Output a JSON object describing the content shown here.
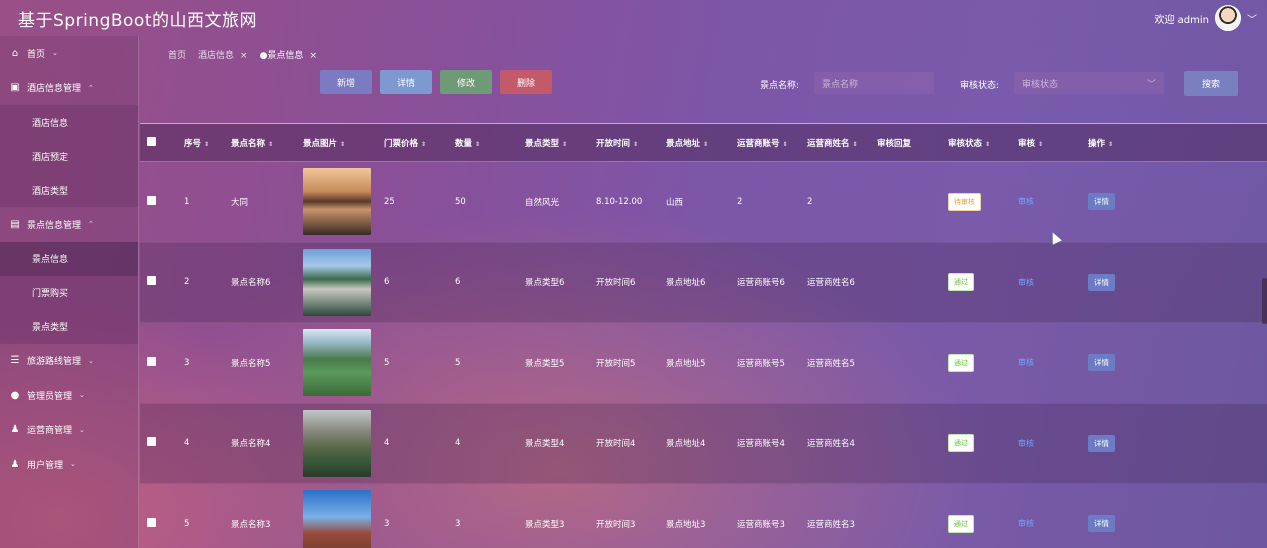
{
  "app_title": "基于SpringBoot的山西文旅网",
  "user": {
    "welcome": "欢迎 admin",
    "chevron": "﹀"
  },
  "sidebar": [
    {
      "label": "首页",
      "icon": "home-icon",
      "sub": []
    },
    {
      "label": "酒店信息管理",
      "icon": "hotel-icon",
      "sub": [
        "酒店信息",
        "酒店预定",
        "酒店类型"
      ]
    },
    {
      "label": "景点信息管理",
      "icon": "scenic-icon",
      "sub": [
        "景点信息",
        "门票购买",
        "景点类型"
      ]
    },
    {
      "label": "旅游路线管理",
      "icon": "route-icon",
      "sub": []
    },
    {
      "label": "管理员管理",
      "icon": "admin-icon",
      "sub": []
    },
    {
      "label": "运营商管理",
      "icon": "operator-icon",
      "sub": []
    },
    {
      "label": "用户管理",
      "icon": "user-icon",
      "sub": []
    }
  ],
  "breadcrumbs": {
    "home": "首页",
    "tab1": "酒店信息",
    "tab2": "●景点信息",
    "close": "×"
  },
  "toolbar": {
    "add": "新增",
    "detail": "详情",
    "edit": "修改",
    "delete": "删除"
  },
  "filters": {
    "name_label": "景点名称:",
    "name_placeholder": "景点名称",
    "status_label": "审核状态:",
    "status_placeholder": "审核状态",
    "search": "搜索"
  },
  "table": {
    "headers": [
      "序号",
      "景点名称",
      "景点图片",
      "门票价格",
      "数量",
      "景点类型",
      "开放时间",
      "景点地址",
      "运营商账号",
      "运营商姓名",
      "审核回复",
      "审核状态",
      "审核",
      "操作"
    ],
    "rows": [
      {
        "idx": "1",
        "name": "大同",
        "price": "25",
        "qty": "50",
        "type": "自然风光",
        "time": "8.10-12.00",
        "addr": "山西",
        "acct": "2",
        "oname": "2",
        "reply": "",
        "status": "待审核",
        "status_kind": "pending",
        "audit": "审核",
        "op": "详情",
        "img": "lake"
      },
      {
        "idx": "2",
        "name": "景点名称6",
        "price": "6",
        "qty": "6",
        "type": "景点类型6",
        "time": "开放时间6",
        "addr": "景点地址6",
        "acct": "运营商账号6",
        "oname": "运营商姓名6",
        "reply": "",
        "status": "通过",
        "status_kind": "passed",
        "audit": "审核",
        "op": "详情",
        "img": "bridge"
      },
      {
        "idx": "3",
        "name": "景点名称5",
        "price": "5",
        "qty": "5",
        "type": "景点类型5",
        "time": "开放时间5",
        "addr": "景点地址5",
        "acct": "运营商账号5",
        "oname": "运营商姓名5",
        "reply": "",
        "status": "通过",
        "status_kind": "passed",
        "audit": "审核",
        "op": "详情",
        "img": "river"
      },
      {
        "idx": "4",
        "name": "景点名称4",
        "price": "4",
        "qty": "4",
        "type": "景点类型4",
        "time": "开放时间4",
        "addr": "景点地址4",
        "acct": "运营商账号4",
        "oname": "运营商姓名4",
        "reply": "",
        "status": "通过",
        "status_kind": "passed",
        "audit": "审核",
        "op": "详情",
        "img": "peaks"
      },
      {
        "idx": "5",
        "name": "景点名称3",
        "price": "3",
        "qty": "3",
        "type": "景点类型3",
        "time": "开放时间3",
        "addr": "景点地址3",
        "acct": "运营商账号3",
        "oname": "运营商姓名3",
        "reply": "",
        "status": "通过",
        "status_kind": "passed",
        "audit": "审核",
        "op": "详情",
        "img": "pagoda"
      }
    ]
  },
  "colors": {
    "add": "#7b7bc4",
    "detail": "#7e98d0",
    "edit": "#6f9a78",
    "delete": "#c35a6a"
  }
}
